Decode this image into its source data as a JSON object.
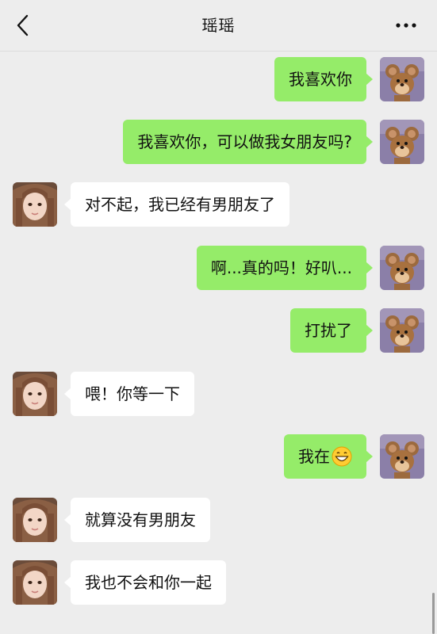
{
  "header": {
    "title": "瑶瑶",
    "back_icon": "chevron-left-icon",
    "more_icon": "more-dots-icon"
  },
  "colors": {
    "background": "#ededed",
    "my_bubble": "#95ec69",
    "their_bubble": "#ffffff"
  },
  "messages": [
    {
      "sender": "me",
      "text": "我喜欢你"
    },
    {
      "sender": "me",
      "text": "我喜欢你，可以做我女朋友吗?"
    },
    {
      "sender": "other",
      "text": "对不起，我已经有男朋友了"
    },
    {
      "sender": "me",
      "text": "啊...真的吗！好叭..."
    },
    {
      "sender": "me",
      "text": "打扰了"
    },
    {
      "sender": "other",
      "text": "喂！你等一下"
    },
    {
      "sender": "me",
      "text": "我在",
      "emoji": "grinning-face-icon"
    },
    {
      "sender": "other",
      "text": "就算没有男朋友"
    },
    {
      "sender": "other",
      "text": "我也不会和你一起"
    }
  ]
}
